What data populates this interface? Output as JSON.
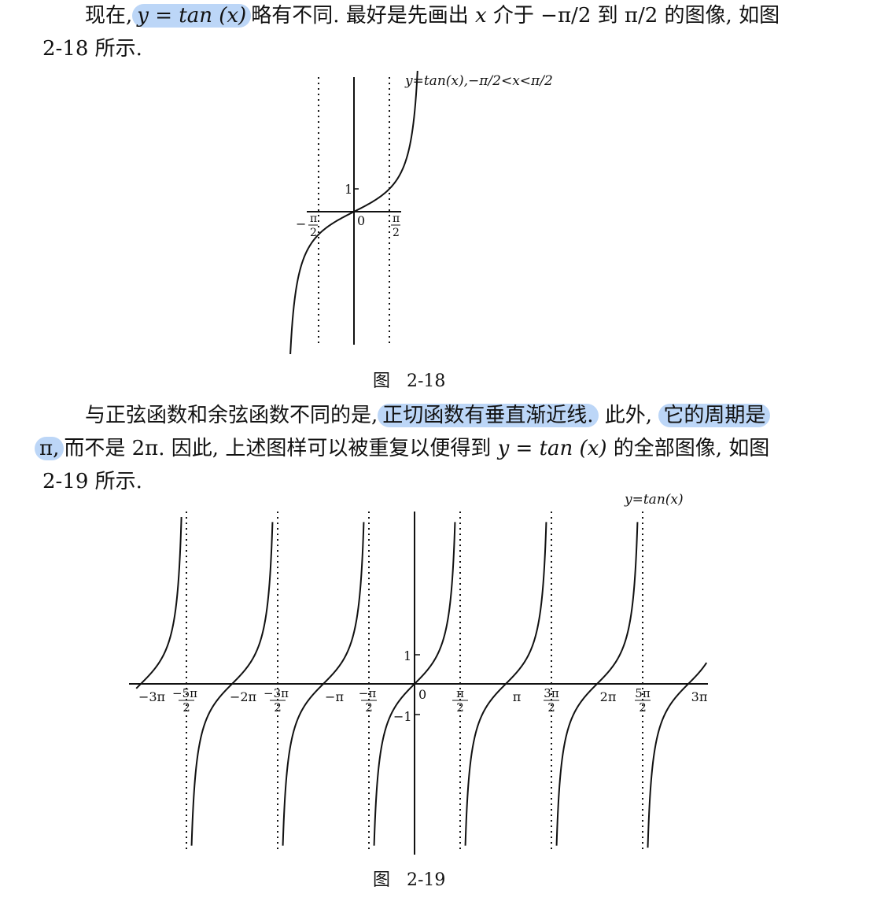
{
  "paragraph1": {
    "line1": {
      "lead": "现在,",
      "highlight": "y = tan (x)",
      "rest_a": "略有不同. 最好是先画出",
      "var_x": "x",
      "rest_b": "介于 −π/2 到 π/2 的图像, 如图"
    },
    "line2": "2-18 所示."
  },
  "figure1": {
    "curve_label": "y=tan(x),−π/2<x<π/2",
    "tick_1": "1",
    "origin": "0",
    "left_num": "π",
    "left_den": "2",
    "left_minus": "−",
    "right_num": "π",
    "right_den": "2",
    "caption_prefix": "图",
    "caption_number": "2-18"
  },
  "paragraph2": {
    "line1": {
      "lead": "与正弦函数和余弦函数不同的是,",
      "highlight1": "正切函数有垂直渐近线.",
      "mid": "此外,",
      "highlight2": "它的周期是"
    },
    "line2": {
      "highlight": "π,",
      "rest": "而不是 2π. 因此, 上述图样可以被重复以便得到",
      "formula": "y = tan (x)",
      "tail": "的全部图像, 如图"
    },
    "line3": "2-19 所示."
  },
  "figure2": {
    "curve_label": "y=tan(x)",
    "tick_1": "1",
    "tick_neg1": "−1",
    "origin": "0",
    "x_ticks": [
      {
        "num": "−3π",
        "den": ""
      },
      {
        "num": "−5π",
        "den": "2"
      },
      {
        "num": "−2π",
        "den": ""
      },
      {
        "num": "−3π",
        "den": "2"
      },
      {
        "num": "−π",
        "den": ""
      },
      {
        "num": "−π",
        "den": "2"
      },
      {
        "num": "π",
        "den": "2"
      },
      {
        "num": "π",
        "den": ""
      },
      {
        "num": "3π",
        "den": "2"
      },
      {
        "num": "2π",
        "den": ""
      },
      {
        "num": "5π",
        "den": "2"
      },
      {
        "num": "3π",
        "den": ""
      }
    ],
    "caption_prefix": "图",
    "caption_number": "2-19"
  },
  "chart_data": [
    {
      "type": "line",
      "function": "tan(x)",
      "x_range": [
        "−π/2",
        "π/2"
      ],
      "x_ticks": [
        "−π/2",
        "0",
        "π/2"
      ],
      "y_ticks": [
        "1"
      ],
      "asymptotes": [
        "x = −π/2",
        "x = π/2"
      ],
      "legend": "y=tan(x),−π/2<x<π/2"
    },
    {
      "type": "line",
      "function": "tan(x)",
      "x_range": [
        "−3π",
        "3π"
      ],
      "x_ticks": [
        "−3π",
        "−5π/2",
        "−2π",
        "−3π/2",
        "−π",
        "−π/2",
        "0",
        "π/2",
        "π",
        "3π/2",
        "2π",
        "5π/2",
        "3π"
      ],
      "y_ticks": [
        "1",
        "−1"
      ],
      "asymptotes": [
        "x = −5π/2",
        "x = −3π/2",
        "x = −π/2",
        "x = π/2",
        "x = 3π/2",
        "x = 5π/2"
      ],
      "legend": "y=tan(x)"
    }
  ]
}
